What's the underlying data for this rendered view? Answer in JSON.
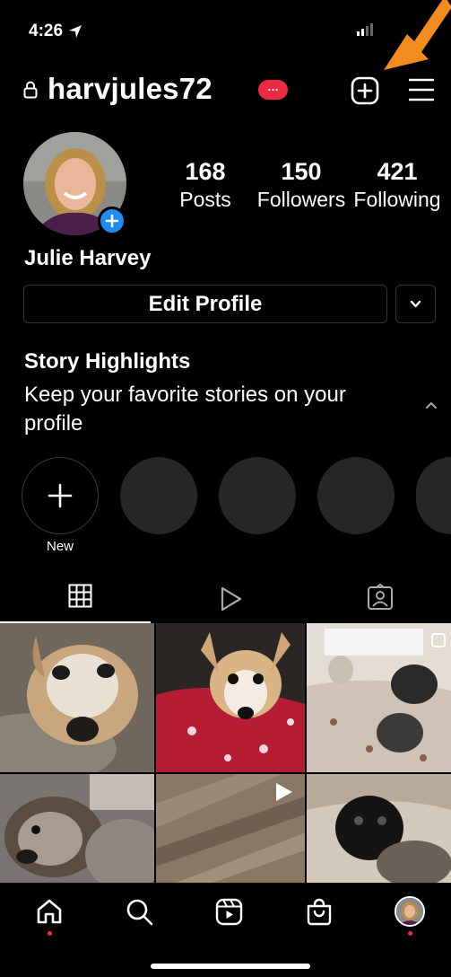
{
  "status": {
    "time": "4:26"
  },
  "header": {
    "username": "harvjules72",
    "badge": "…"
  },
  "profile": {
    "stats": [
      {
        "value": "168",
        "label": "Posts"
      },
      {
        "value": "150",
        "label": "Followers"
      },
      {
        "value": "421",
        "label": "Following"
      }
    ],
    "name": "Julie Harvey",
    "edit_label": "Edit Profile"
  },
  "highlights": {
    "title": "Story Highlights",
    "text": "Keep your favorite stories on your profile",
    "new_label": "New"
  },
  "tabs": [
    "grid-icon",
    "reels-icon",
    "tagged-icon"
  ],
  "nav": [
    "home-icon",
    "search-icon",
    "reels-icon",
    "shop-icon",
    "profile-avatar"
  ],
  "colors": {
    "accent": "#1f8cf0",
    "notification": "#ed2b45",
    "arrow": "#f28c1e"
  }
}
